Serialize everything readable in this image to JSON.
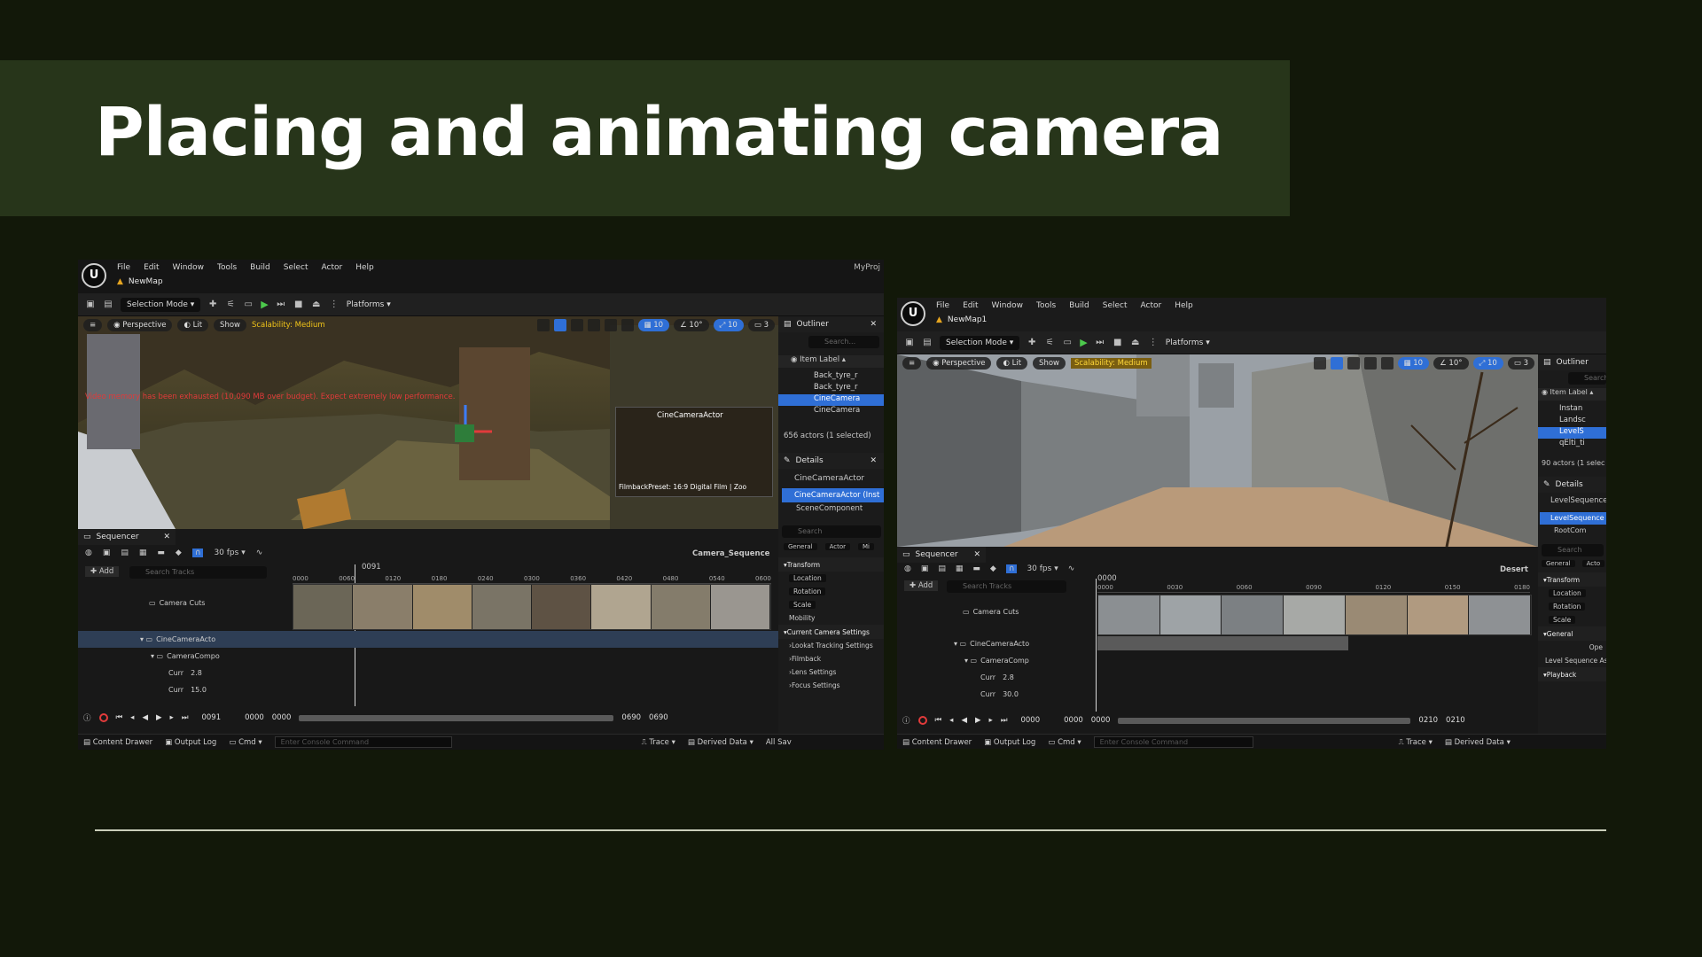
{
  "slide": {
    "title": "Placing and animating camera"
  },
  "editors": [
    {
      "menus": [
        "File",
        "Edit",
        "Window",
        "Tools",
        "Build",
        "Select",
        "Actor",
        "Help"
      ],
      "project": "MyProj",
      "map_tab": "NewMap",
      "toolbar": {
        "selection_mode": "Selection Mode",
        "platforms": "Platforms"
      },
      "viewport": {
        "perspective": "Perspective",
        "lit": "Lit",
        "show": "Show",
        "scalability": "Scalability: Medium",
        "grid_snap": "10",
        "rot_snap": "10°",
        "scale_snap": "10",
        "cam_speed": "3",
        "warning": "Video memory has been exhausted (10,090 MB over budget). Expect extremely low performance.",
        "pip_label": "CineCameraActor",
        "pip_filmback": "FilmbackPreset: 16:9 Digital Film | Zoo"
      },
      "outliner": {
        "title": "Outliner",
        "search_placeholder": "Search...",
        "item_label": "Item Label",
        "rows": [
          "Back_tyre_r",
          "Back_tyre_r",
          "CineCamera",
          "CineCamera"
        ],
        "count": "656 actors (1 selected)"
      },
      "details": {
        "title": "Details",
        "actor": "CineCameraActor",
        "instance": "CineCameraActor (Inst",
        "component": "SceneComponent",
        "search_placeholder": "Search",
        "tabs": [
          "General",
          "Actor",
          "Mi"
        ],
        "sections": [
          "Transform",
          "Location",
          "Rotation",
          "Scale",
          "Mobility",
          "Current Camera Settings",
          "Lookat Tracking Settings",
          "Filmback",
          "Lens Settings",
          "Focus Settings"
        ]
      },
      "sequencer": {
        "tab": "Sequencer",
        "fps": "30 fps",
        "sequence_name": "Camera_Sequence",
        "add": "Add",
        "search_placeholder": "Search Tracks",
        "current_frame": "0091",
        "tracks": [
          {
            "label": "Camera Cuts"
          },
          {
            "label": "CineCameraActo"
          },
          {
            "label": "CameraCompo"
          },
          {
            "label": "Curr",
            "value": "2.8"
          },
          {
            "label": "Curr",
            "value": "15.0"
          }
        ],
        "ruler": [
          "0000",
          "0060",
          "0120",
          "0180",
          "0240",
          "0300",
          "0360",
          "0420",
          "0480",
          "0540",
          "0600"
        ],
        "transport_frame": "0091",
        "range_start_a": "0000",
        "range_start_b": "0000",
        "range_end_a": "0690",
        "range_end_b": "0690"
      },
      "statusbar": {
        "content_drawer": "Content Drawer",
        "output_log": "Output Log",
        "cmd": "Cmd",
        "console_placeholder": "Enter Console Command",
        "trace": "Trace",
        "derived_data": "Derived Data",
        "all_saved": "All Sav"
      }
    },
    {
      "menus": [
        "File",
        "Edit",
        "Window",
        "Tools",
        "Build",
        "Select",
        "Actor",
        "Help"
      ],
      "map_tab": "NewMap1",
      "toolbar": {
        "selection_mode": "Selection Mode",
        "platforms": "Platforms"
      },
      "viewport": {
        "perspective": "Perspective",
        "lit": "Lit",
        "show": "Show",
        "scalability": "Scalability: Medium",
        "grid_snap": "10",
        "rot_snap": "10°",
        "scale_snap": "10",
        "cam_speed": "3"
      },
      "outliner": {
        "title": "Outliner",
        "search_placeholder": "Search",
        "item_label": "Item Label",
        "rows": [
          "Instan",
          "Landsc",
          "LevelS",
          "qElti_ti"
        ],
        "count": "90 actors (1 selec"
      },
      "details": {
        "title": "Details",
        "actor": "LevelSequence",
        "instance": "LevelSequence",
        "component": "RootCom",
        "search_placeholder": "Search",
        "tabs": [
          "General",
          "Acto"
        ],
        "sections": [
          "Transform",
          "Location",
          "Rotation",
          "Scale",
          "General",
          "Ope",
          "Level Sequence Ass",
          "Playback"
        ]
      },
      "sequencer": {
        "tab": "Sequencer",
        "fps": "30 fps",
        "sequence_name": "Desert",
        "add": "Add",
        "search_placeholder": "Search Tracks",
        "current_frame": "0000",
        "tracks": [
          {
            "label": "Camera Cuts"
          },
          {
            "label": "CineCameraActo"
          },
          {
            "label": "CameraComp"
          },
          {
            "label": "Curr",
            "value": "2.8"
          },
          {
            "label": "Curr",
            "value": "30.0"
          }
        ],
        "ruler": [
          "0000",
          "0030",
          "0060",
          "0090",
          "0120",
          "0150",
          "0180"
        ],
        "transport_frame": "0000",
        "range_start_a": "0000",
        "range_start_b": "0000",
        "range_end_a": "0210",
        "range_end_b": "0210"
      },
      "statusbar": {
        "content_drawer": "Content Drawer",
        "output_log": "Output Log",
        "cmd": "Cmd",
        "console_placeholder": "Enter Console Command",
        "trace": "Trace",
        "derived_data": "Derived Data"
      }
    }
  ],
  "colors": {
    "bg": "#121809",
    "band": "#27351a",
    "accent_blue": "#2f6fd6",
    "warning_red": "#e03a3a",
    "scalability_yellow": "#f0c419"
  }
}
